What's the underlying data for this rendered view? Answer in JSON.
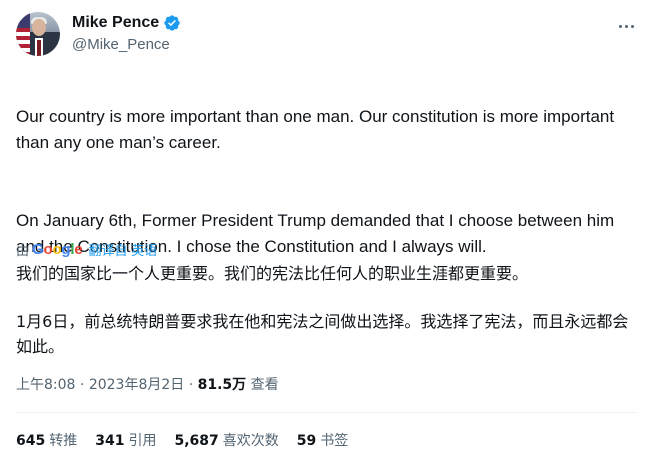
{
  "author": {
    "name": "Mike Pence",
    "handle": "@Mike_Pence",
    "verified_color": "#1d9bf0"
  },
  "tweet": {
    "paragraphs": [
      "Our country is more important than one man. Our constitution is more important than any one man’s career.",
      "On January 6th, Former President Trump demanded that I choose between him and the Constitution. I chose the Constitution and I always will."
    ]
  },
  "translation": {
    "prefix": "由",
    "provider": "Google",
    "link_label": "翻译自 英语",
    "paragraphs": [
      "我们的国家比一个人更重要。我们的宪法比任何人的职业生涯都更重要。",
      "1月6日，前总统特朗普要求我在他和宪法之间做出选择。我选择了宪法，而且永远都会如此。"
    ]
  },
  "meta": {
    "time": "上午8:08",
    "separator": " · ",
    "date": "2023年8月2日",
    "views_count": "81.5万",
    "views_label": "查看"
  },
  "stats": [
    {
      "count": "645",
      "label": "转推"
    },
    {
      "count": "341",
      "label": "引用"
    },
    {
      "count": "5,687",
      "label": "喜欢次数"
    },
    {
      "count": "59",
      "label": "书签"
    }
  ]
}
